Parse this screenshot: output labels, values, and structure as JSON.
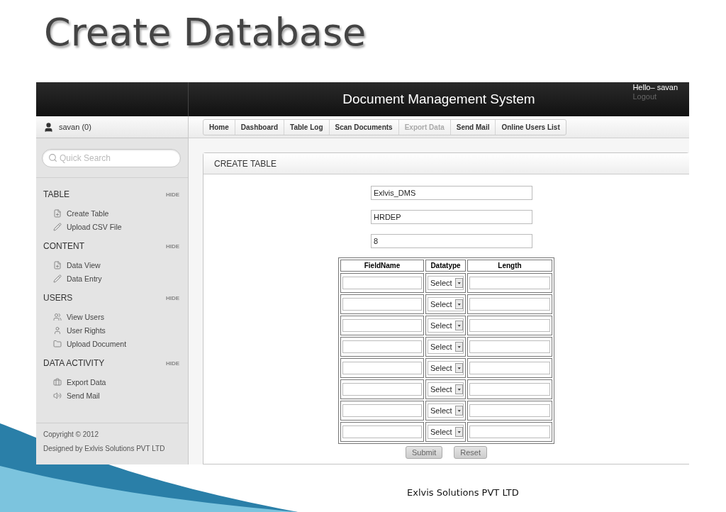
{
  "slide": {
    "title": "Create Database",
    "footer": "Exlvis Solutions PVT LTD"
  },
  "header": {
    "title": "Document Management System",
    "greeting": "Hello– savan",
    "logout": "Logout"
  },
  "sidebar": {
    "user": "savan (0)",
    "search": {
      "placeholder": "Quick Search"
    },
    "sections": [
      {
        "title": "TABLE",
        "toggle": "HIDE",
        "items": [
          "Create Table",
          "Upload CSV File"
        ]
      },
      {
        "title": "CONTENT",
        "toggle": "HIDE",
        "items": [
          "Data View",
          "Data Entry"
        ]
      },
      {
        "title": "USERS",
        "toggle": "HIDE",
        "items": [
          "View Users",
          "User Rights",
          "Upload Document"
        ]
      },
      {
        "title": "DATA ACTIVITY",
        "toggle": "HIDE",
        "items": [
          "Export Data",
          "Send Mail"
        ]
      }
    ],
    "copyright": "Copyright © 2012",
    "designed_by": "Designed by Exlvis Solutions PVT LTD"
  },
  "breadcrumbs": [
    {
      "label": "Home",
      "disabled": false
    },
    {
      "label": "Dashboard",
      "disabled": false
    },
    {
      "label": "Table Log",
      "disabled": false
    },
    {
      "label": "Scan Documents",
      "disabled": false
    },
    {
      "label": "Export Data",
      "disabled": true
    },
    {
      "label": "Send Mail",
      "disabled": false
    },
    {
      "label": "Online Users List",
      "disabled": false
    }
  ],
  "panel": {
    "title": "CREATE TABLE",
    "fields": [
      "Exlvis_DMS",
      "HRDEP",
      "8"
    ],
    "table": {
      "columns": [
        "FieldName",
        "Datatype",
        "Length"
      ],
      "rows": [
        {
          "datatype": "Select"
        },
        {
          "datatype": "Select"
        },
        {
          "datatype": "Select"
        },
        {
          "datatype": "Select"
        },
        {
          "datatype": "Select"
        },
        {
          "datatype": "Select"
        },
        {
          "datatype": "Select"
        },
        {
          "datatype": "Select"
        }
      ]
    },
    "buttons": [
      "Submit",
      "Reset"
    ]
  }
}
